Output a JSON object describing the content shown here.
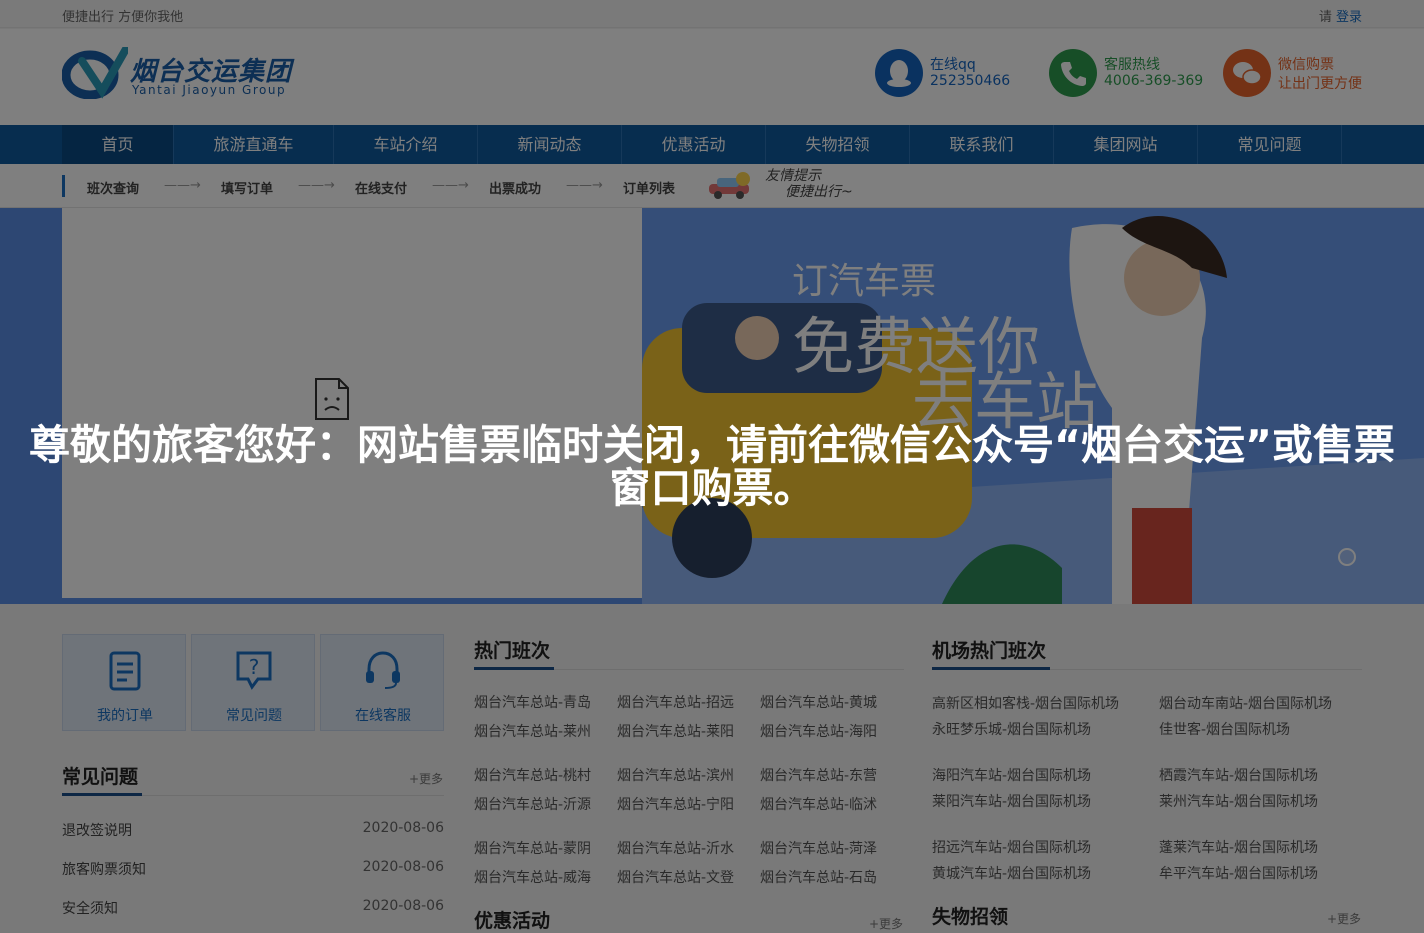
{
  "topbar": {
    "slogan": "便捷出行 方便你我他",
    "login_prefix": "请",
    "login_link": "登录"
  },
  "header": {
    "logo_cn": "烟台交运集团",
    "logo_en": "Yantai Jiaoyun Group",
    "contacts": [
      {
        "title": "在线qq",
        "value": "252350466",
        "icon": "qq-icon",
        "color": "#1565c0"
      },
      {
        "title": "客服热线",
        "value": "4006-369-369",
        "icon": "phone-icon",
        "color": "#2e9d4f"
      },
      {
        "title": "微信购票",
        "value": "让出门更方便",
        "icon": "wechat-icon",
        "color": "#e8642c"
      }
    ]
  },
  "nav": {
    "items": [
      "首页",
      "旅游直通车",
      "车站介绍",
      "新闻动态",
      "优惠活动",
      "失物招领",
      "联系我们",
      "集团网站",
      "常见问题"
    ]
  },
  "steps": {
    "items": [
      "班次查询",
      "填写订单",
      "在线支付",
      "出票成功",
      "订单列表"
    ],
    "arrow": "——→",
    "tip_line1": "友情提示",
    "tip_line2": "便捷出行~"
  },
  "banner": {
    "line1": "订汽车票",
    "line2": "免费送你",
    "line3": "去车站"
  },
  "quick": [
    {
      "label": "我的订单",
      "icon": "order-icon"
    },
    {
      "label": "常见问题",
      "icon": "question-icon"
    },
    {
      "label": "在线客服",
      "icon": "headset-icon"
    }
  ],
  "faq": {
    "title": "常见问题",
    "more": "+更多",
    "items": [
      {
        "title": "退改签说明",
        "date": "2020-08-06"
      },
      {
        "title": "旅客购票须知",
        "date": "2020-08-06"
      },
      {
        "title": "安全须知",
        "date": "2020-08-06"
      }
    ]
  },
  "hot_routes": {
    "title": "热门班次",
    "routes": [
      "烟台汽车总站-青岛",
      "烟台汽车总站-招远",
      "烟台汽车总站-黄城",
      "烟台汽车总站-莱州",
      "烟台汽车总站-莱阳",
      "烟台汽车总站-海阳",
      "烟台汽车总站-桃村",
      "烟台汽车总站-滨州",
      "烟台汽车总站-东营",
      "烟台汽车总站-沂源",
      "烟台汽车总站-宁阳",
      "烟台汽车总站-临沭",
      "烟台汽车总站-蒙阴",
      "烟台汽车总站-沂水",
      "烟台汽车总站-菏泽",
      "烟台汽车总站-威海",
      "烟台汽车总站-文登",
      "烟台汽车总站-石岛"
    ]
  },
  "airport_routes": {
    "title": "机场热门班次",
    "routes": [
      "高新区相如客栈-烟台国际机场",
      "烟台动车南站-烟台国际机场",
      "永旺梦乐城-烟台国际机场",
      "佳世客-烟台国际机场",
      "海阳汽车站-烟台国际机场",
      "栖霞汽车站-烟台国际机场",
      "莱阳汽车站-烟台国际机场",
      "莱州汽车站-烟台国际机场",
      "招远汽车站-烟台国际机场",
      "蓬莱汽车站-烟台国际机场",
      "黄城汽车站-烟台国际机场",
      "牟平汽车站-烟台国际机场"
    ]
  },
  "promo": {
    "title": "优惠活动",
    "more": "+更多"
  },
  "lost": {
    "title": "失物招领",
    "more": "+更多"
  },
  "notice": {
    "text": "尊敬的旅客您好：网站售票临时关闭，请前往微信公众号“烟台交运”或售票窗口购票。"
  }
}
